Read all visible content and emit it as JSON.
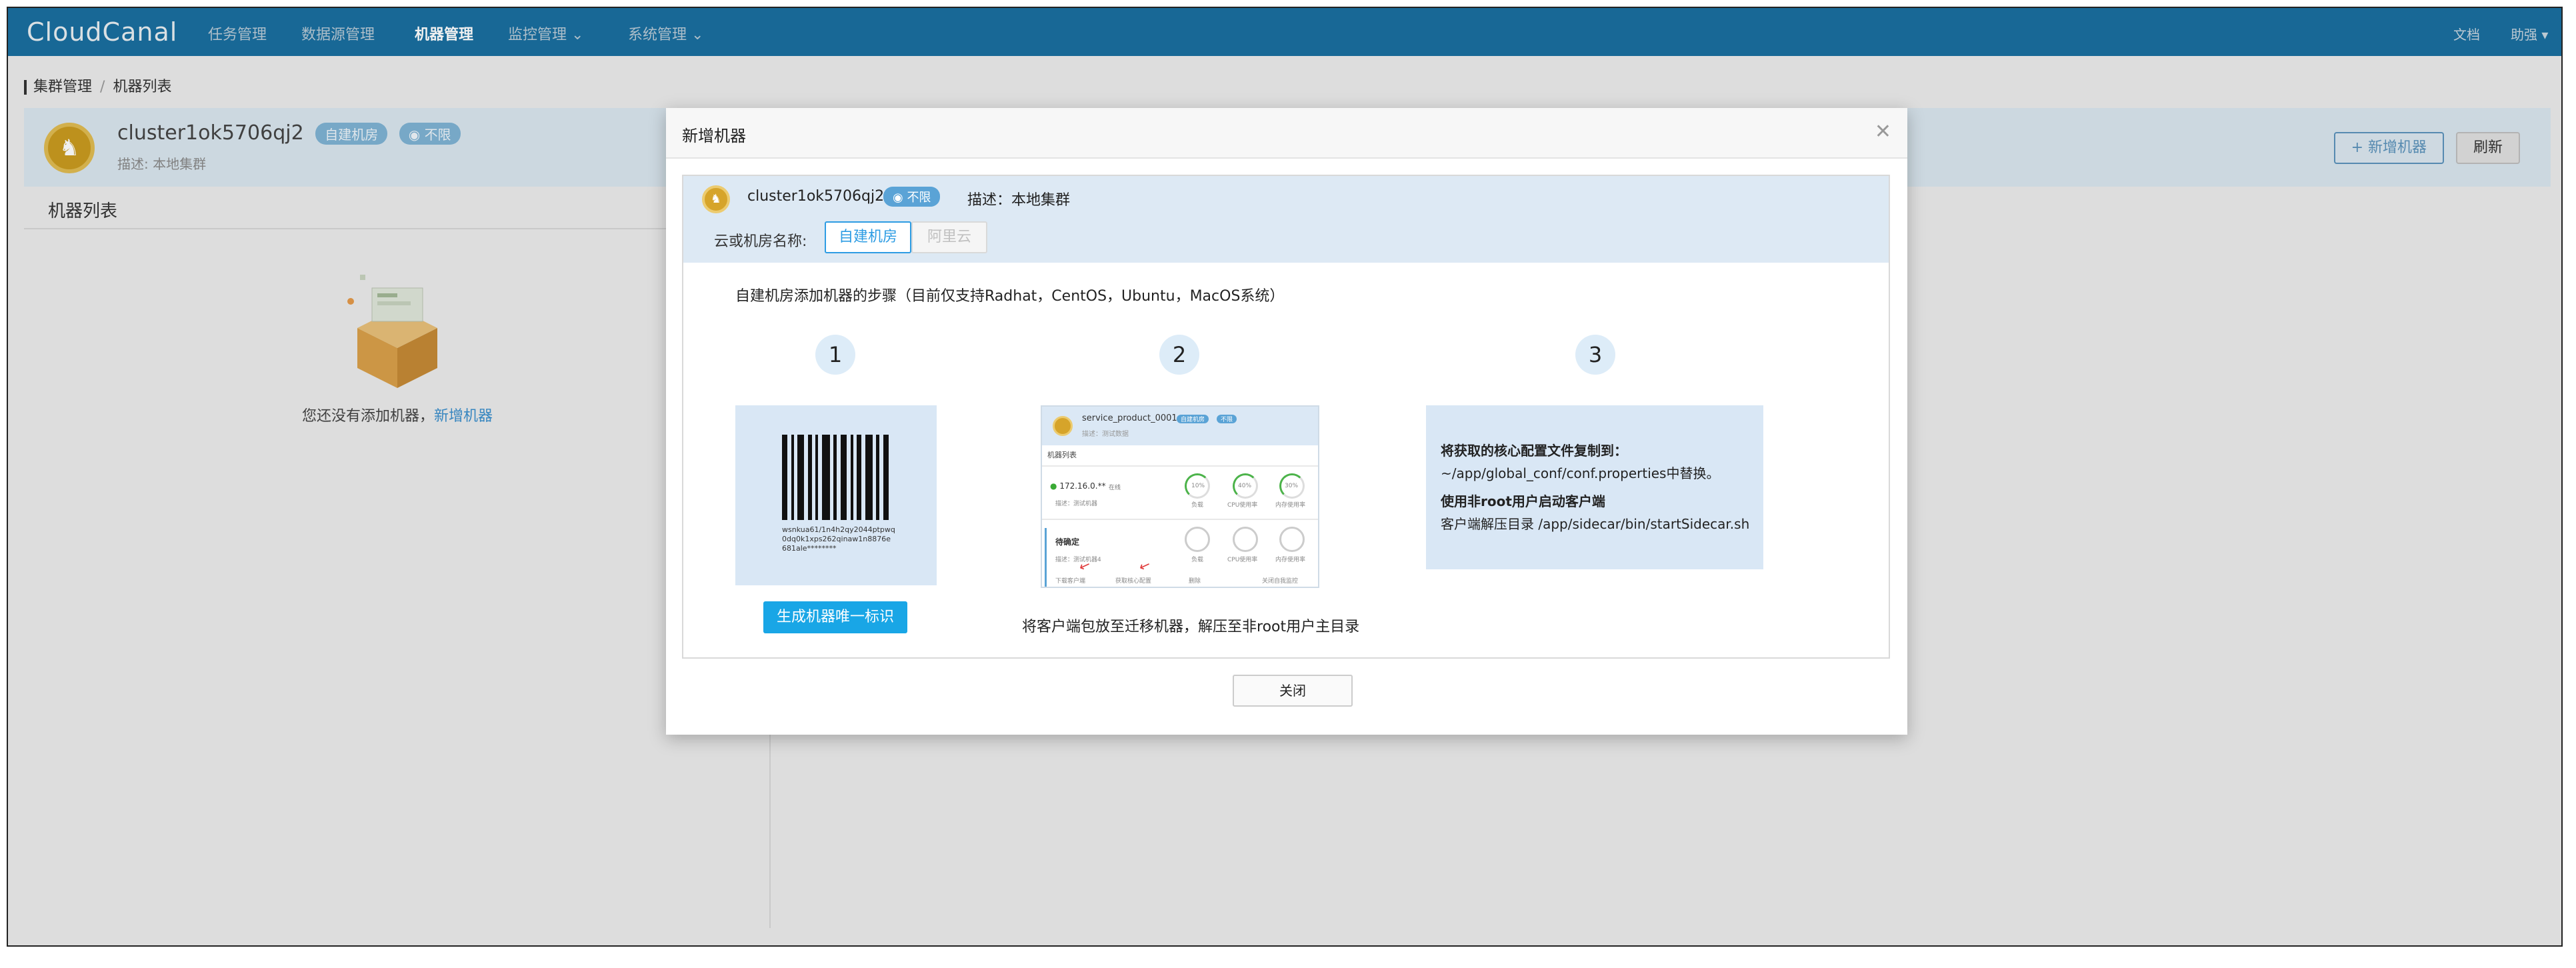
{
  "app": {
    "logo": "CloudCanal"
  },
  "nav": {
    "items": [
      {
        "label": "任务管理"
      },
      {
        "label": "数据源管理"
      },
      {
        "label": "机器管理"
      },
      {
        "label": "监控管理 ⌄"
      },
      {
        "label": "系统管理 ⌄"
      }
    ],
    "docs": "文档",
    "user": "助强 ▾"
  },
  "breadcrumb": {
    "parent": "集群管理",
    "separator": "/",
    "current": "机器列表"
  },
  "cluster": {
    "name": "cluster1ok5706qj2",
    "tag_type": "自建机房",
    "tag_region": "不限",
    "desc_label": "描述:",
    "desc_value": "本地集群",
    "add_button": "+ 新增机器",
    "refresh_button": "刷新"
  },
  "left_panel": {
    "title": "机器列表",
    "empty_text": "您还没有添加机器，",
    "empty_link": "新增机器"
  },
  "modal": {
    "title": "新增机器",
    "close_icon": "close-icon",
    "cluster_name": "cluster1ok5706qj2",
    "region_tag": "不限",
    "desc": "描述：本地集群",
    "cloud_label": "云或机房名称:",
    "cloud_options": [
      "自建机房",
      "阿里云"
    ],
    "steps_title": "自建机房添加机器的步骤（目前仅支持Radhat，CentOS，Ubuntu，MacOS系统）",
    "steps": [
      "1",
      "2",
      "3"
    ],
    "barcode_text": "wsnkua61/1n4h2qy2044ptpwq0dq0k1xps262qinaw1n8876e681ale********",
    "generate_button": "生成机器唯一标识",
    "step2_text": "将客户端包放至迁移机器，解压至非root用户主目录",
    "step2_preview": {
      "title": "service_product_0001",
      "subtitle": "描述：测试数据",
      "tag1": "自建机房",
      "tag2": "不限",
      "list_label": "机器列表",
      "ip": "172.16.0.**",
      "status": "在线",
      "desc1": "描述：测试机器",
      "gauge_labels": [
        "负载",
        "CPU使用率",
        "内存使用率"
      ],
      "gauge_values": [
        "10%",
        "40%",
        "30%"
      ],
      "pending_name": "待确定",
      "desc2": "描述：测试机器4",
      "actions": [
        "下载客户端",
        "获取核心配置",
        "删除",
        "关闭自我监控"
      ]
    },
    "step3": {
      "line1": "将获取的核心配置文件复制到：",
      "line2": "~/app/global_conf/conf.properties中替换。",
      "line3": "使用非root用户启动客户端",
      "line4": "客户端解压目录 /app/sidecar/bin/startSidecar.sh"
    },
    "close_button": "关闭"
  }
}
